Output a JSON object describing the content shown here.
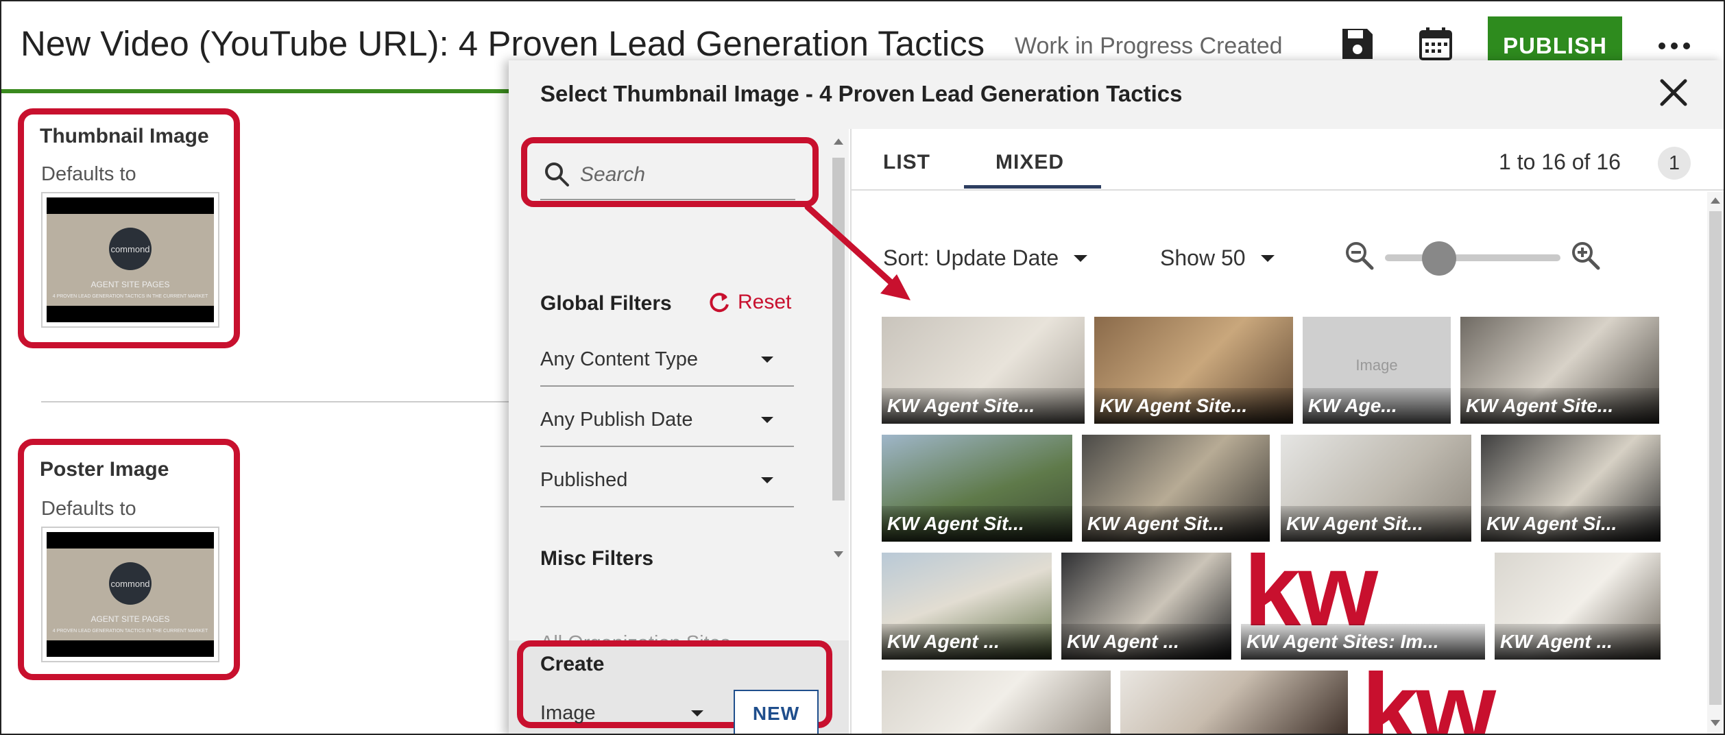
{
  "header": {
    "title": "New Video (YouTube URL): 4 Proven Lead Generation Tactics",
    "status": "Work in Progress Created",
    "publish_label": "PUBLISH",
    "icons": [
      "save-icon",
      "calendar-icon",
      "more-icon"
    ],
    "accent_color": "#2e8b1e"
  },
  "left_panel": {
    "thumbnail_label": "Thumbnail Image",
    "thumbnail_default": "Defaults to",
    "poster_label": "Poster Image",
    "poster_default": "Defaults to",
    "preview": {
      "logo_text": "commond",
      "caption": "AGENT SITE PAGES",
      "subcaption": "4 PROVEN LEAD GENERATION TACTICS IN THE CURRENT MARKET"
    }
  },
  "modal": {
    "title": "Select Thumbnail Image - 4 Proven Lead Generation Tactics",
    "close_icon": "close-icon",
    "search": {
      "placeholder": "Search",
      "value": ""
    },
    "global_filters_label": "Global Filters",
    "reset_label": "Reset",
    "filters": [
      "Any Content Type",
      "Any Publish Date",
      "Published"
    ],
    "misc_filters_label": "Misc Filters",
    "cut_off_text": "All Organization Sites",
    "create": {
      "label": "Create",
      "type_value": "Image",
      "new_label": "NEW"
    },
    "tabs": [
      "LIST",
      "MIXED"
    ],
    "active_tab": "MIXED",
    "result_count": "1 to 16 of 16",
    "page_number": "1",
    "sort_label": "Sort: Update Date",
    "show_label": "Show 50",
    "tiles": [
      "KW Agent Site...",
      "KW Agent Site...",
      "KW Age...",
      "KW Agent Site...",
      "KW Agent Sit...",
      "KW Agent Sit...",
      "KW Agent Sit...",
      "KW Agent Si...",
      "KW Agent ...",
      "KW Agent ...",
      "KW Agent Sites: Im...",
      "KW Agent ..."
    ],
    "placeholder_tile_text": "Image",
    "kw_logo_text": "kw",
    "brand_color": "#c8102e"
  }
}
